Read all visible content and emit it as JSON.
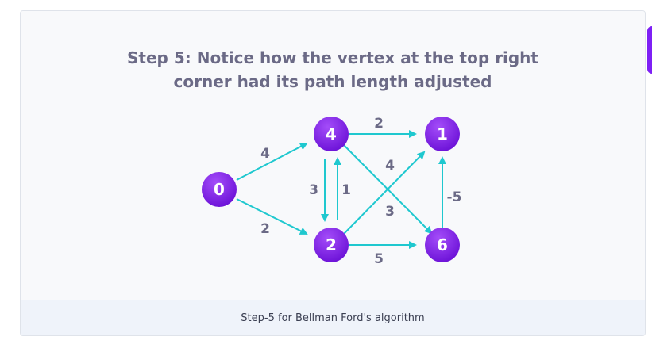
{
  "figure": {
    "title_line1": "Step 5: Notice how the vertex at the top right",
    "title_line2": "corner had its path length adjusted",
    "caption": "Step-5 for Bellman Ford's algorithm"
  },
  "graph": {
    "nodes": [
      {
        "id": "0",
        "label": "0"
      },
      {
        "id": "4",
        "label": "4"
      },
      {
        "id": "2",
        "label": "2"
      },
      {
        "id": "1",
        "label": "1"
      },
      {
        "id": "6",
        "label": "6"
      }
    ],
    "edges": [
      {
        "from": "0",
        "to": "4",
        "weight": "4"
      },
      {
        "from": "0",
        "to": "2",
        "weight": "2"
      },
      {
        "from": "4",
        "to": "1",
        "weight": "2"
      },
      {
        "from": "4",
        "to": "2",
        "weight": "3"
      },
      {
        "from": "2",
        "to": "4",
        "weight": "1"
      },
      {
        "from": "4",
        "to": "6",
        "weight": "3"
      },
      {
        "from": "2",
        "to": "1",
        "weight": "4"
      },
      {
        "from": "2",
        "to": "6",
        "weight": "5"
      },
      {
        "from": "6",
        "to": "1",
        "weight": "-5"
      }
    ]
  },
  "colors": {
    "node_fill_top": "#9b3cf7",
    "node_fill_bottom": "#6a10d6",
    "edge": "#1fc8cf",
    "text_muted": "#6b6a86",
    "accent_tab": "#7e20f5"
  }
}
